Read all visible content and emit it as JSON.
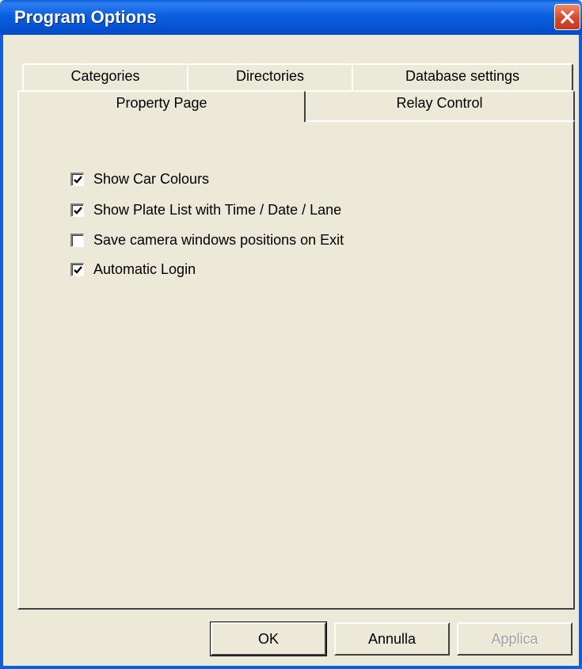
{
  "window": {
    "title": "Program Options"
  },
  "tabs": {
    "row1": [
      "Categories",
      "Directories",
      "Database settings"
    ],
    "row2": [
      "Property Page",
      "Relay Control"
    ],
    "active": "Property Page"
  },
  "options": [
    {
      "label": "Show Car Colours",
      "checked": true
    },
    {
      "label": "Show Plate List with Time / Date / Lane",
      "checked": true
    },
    {
      "label": "Save camera windows positions on Exit",
      "checked": false
    },
    {
      "label": "Automatic Login",
      "checked": true
    }
  ],
  "buttons": {
    "ok": "OK",
    "cancel": "Annulla",
    "apply": "Applica"
  },
  "icons": {
    "close": "close-icon",
    "check": "checkmark-icon"
  }
}
